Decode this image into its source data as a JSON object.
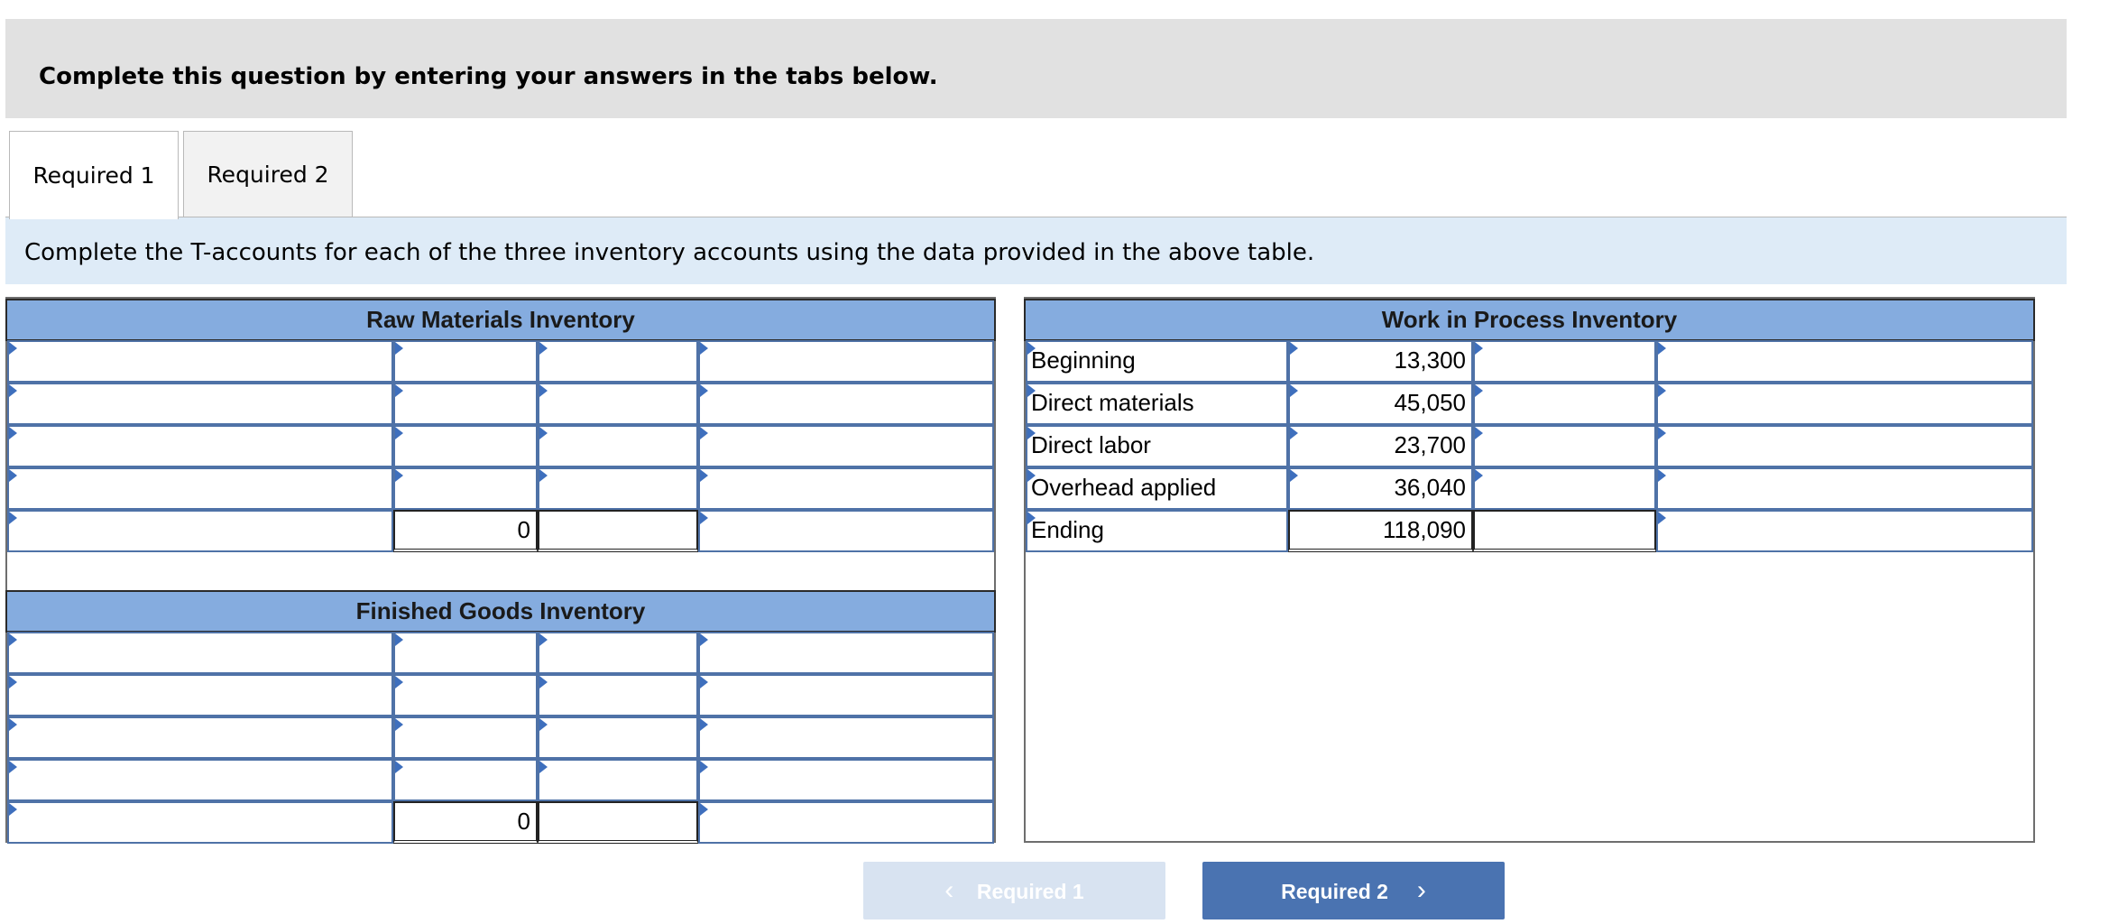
{
  "banner": {
    "text": "Complete this question by entering your answers in the tabs below."
  },
  "tabs": [
    {
      "label": "Required 1"
    },
    {
      "label": "Required 2"
    }
  ],
  "instruction": "Complete the T-accounts for each of the three inventory accounts using the data provided in the above table.",
  "raw_materials": {
    "title": "Raw Materials Inventory",
    "balance": "0"
  },
  "finished_goods": {
    "title": "Finished Goods Inventory",
    "balance": "0"
  },
  "work_in_process": {
    "title": "Work in Process Inventory",
    "rows": [
      {
        "label": "Beginning",
        "amount": "13,300"
      },
      {
        "label": "Direct materials",
        "amount": "45,050"
      },
      {
        "label": "Direct labor",
        "amount": "23,700"
      },
      {
        "label": "Overhead applied",
        "amount": "36,040"
      },
      {
        "label": "Ending",
        "amount": "118,090"
      }
    ]
  },
  "nav": {
    "prev_label": "Required 1",
    "next_label": "Required 2",
    "prev_icon": "chevron-left-icon",
    "next_icon": "chevron-right-icon"
  },
  "colors": {
    "header_blue": "#85acdf",
    "instruction_bg": "#deebf7",
    "button_blue": "#4a73b1",
    "button_disabled": "#d8e3f1"
  }
}
